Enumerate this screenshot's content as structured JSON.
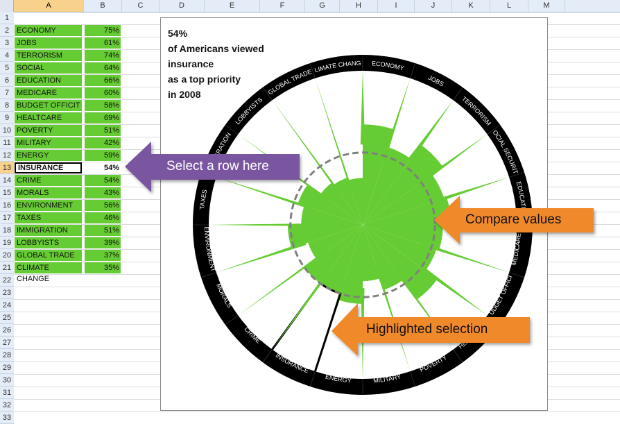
{
  "columns": [
    "A",
    "B",
    "C",
    "D",
    "E",
    "F",
    "G",
    "H",
    "I",
    "J",
    "K",
    "L",
    "M"
  ],
  "selected_column": "A",
  "selected_row": 13,
  "rows": [
    {
      "label": "ECONOMY",
      "value": "75%"
    },
    {
      "label": "JOBS",
      "value": "61%"
    },
    {
      "label": "TERRORISM",
      "value": "74%"
    },
    {
      "label": "SOCIAL SECURITY",
      "value": "64%"
    },
    {
      "label": "EDUCATION",
      "value": "66%"
    },
    {
      "label": "MEDICARE",
      "value": "60%"
    },
    {
      "label": "BUDGET OFFICIT",
      "value": "58%"
    },
    {
      "label": "HEALTCARE",
      "value": "69%"
    },
    {
      "label": "POVERTY",
      "value": "51%"
    },
    {
      "label": "MILITARY",
      "value": "42%"
    },
    {
      "label": "ENERGY",
      "value": "59%"
    },
    {
      "label": "INSURANCE",
      "value": "54%"
    },
    {
      "label": "CRIME",
      "value": "54%"
    },
    {
      "label": "MORALS",
      "value": "43%"
    },
    {
      "label": "ENVIRONMENT",
      "value": "56%"
    },
    {
      "label": "TAXES",
      "value": "46%"
    },
    {
      "label": "IMMIGRATION",
      "value": "51%"
    },
    {
      "label": "LOBBYISTS",
      "value": "39%"
    },
    {
      "label": "GLOBAL TRADE",
      "value": "37%"
    },
    {
      "label": "CLIMATE CHANGE",
      "value": "35%"
    }
  ],
  "headline": {
    "line1": "54%",
    "line2": "of Americans viewed",
    "line3": "insurance",
    "line4": "as a top priority",
    "line5": "in 2008"
  },
  "callouts": {
    "select": "Select a row here",
    "compare": "Compare values",
    "highlight": "Highlighted selection"
  },
  "colors": {
    "green": "#66cc33",
    "ring": "#000000",
    "purple": "#7a55a0",
    "orange": "#f0892a",
    "dash": "#808080"
  },
  "chart_data": {
    "type": "radial-bar",
    "categories": [
      "ECONOMY",
      "JOBS",
      "TERRORISM",
      "SOCIAL SECURITY",
      "EDUCATION",
      "MEDICARE",
      "BUDGET OFFICIT",
      "HEALTCARE",
      "POVERTY",
      "MILITARY",
      "ENERGY",
      "INSURANCE",
      "CRIME",
      "MORALS",
      "ENVIRONMENT",
      "TAXES",
      "IMMIGRATION",
      "LOBBYISTS",
      "GLOBAL TRADE",
      "CLIMATE CHANGE"
    ],
    "values": [
      75,
      61,
      74,
      64,
      66,
      60,
      58,
      69,
      51,
      42,
      59,
      54,
      54,
      43,
      56,
      46,
      51,
      39,
      37,
      35
    ],
    "highlighted": "INSURANCE",
    "reference_value": 54
  }
}
